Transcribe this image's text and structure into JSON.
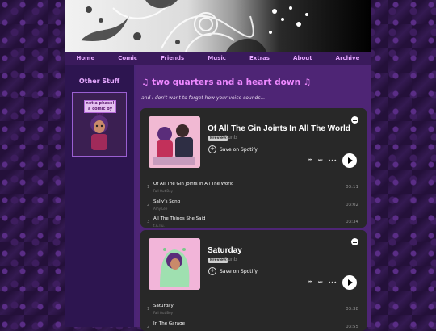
{
  "nav": {
    "items": [
      "Home",
      "Comic",
      "Friends",
      "Music",
      "Extras",
      "About",
      "Archive"
    ]
  },
  "sidebar": {
    "title": "Other Stuff",
    "button_text": "not a phase! a comic by ree"
  },
  "main": {
    "title": "♫ two quarters and a heart down ♫",
    "subtitle": "and I don't want to forget how your voice sounds..."
  },
  "cards": [
    {
      "title": "Of All The Gin Joints In All The World",
      "preview": "Preview",
      "artist": "Bunb",
      "save": "Save on Spotify",
      "tracks": [
        {
          "num": "1",
          "name": "Of All The Gin Joints In All The World",
          "by": "Fall Out Boy",
          "dur": "03:11"
        },
        {
          "num": "2",
          "name": "Sally's Song",
          "by": "Amy Lee",
          "dur": "03:02"
        },
        {
          "num": "3",
          "name": "All The Things She Said",
          "by": "t.A.T.u.",
          "dur": "03:34"
        }
      ]
    },
    {
      "title": "Saturday",
      "preview": "Preview",
      "artist": "Bunb",
      "save": "Save on Spotify",
      "tracks": [
        {
          "num": "1",
          "name": "Saturday",
          "by": "Fall Out Boy",
          "dur": "03:38"
        },
        {
          "num": "2",
          "name": "In The Garage",
          "by": "",
          "dur": "03:55"
        }
      ]
    }
  ],
  "colors": {
    "accent": "#ee88ff",
    "nav_bg": "#3a1a5c",
    "card_bg": "#282828"
  }
}
